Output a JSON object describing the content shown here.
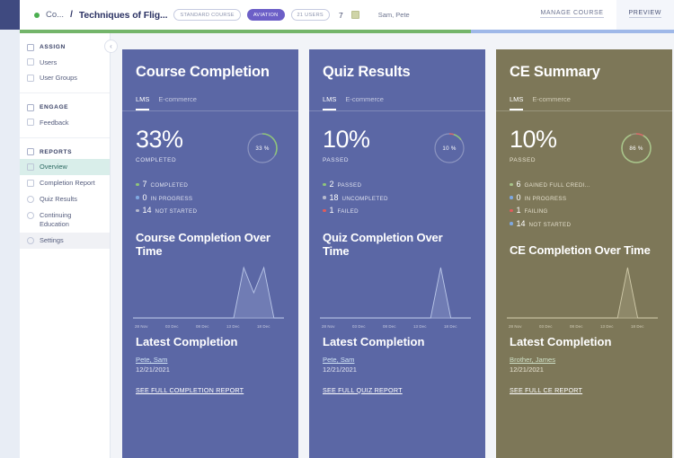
{
  "topbar": {
    "breadcrumb_parent": "Co...",
    "separator": "/",
    "title": "Techniques of Flig...",
    "badges": [
      "STANDARD COURSE",
      "AVIATION",
      "21 USERS"
    ],
    "module_count": "7",
    "assignees": "Sam, Pete",
    "manage_course": "MANAGE COURSE",
    "preview": "PREVIEW",
    "progress_percent": 69,
    "progress_color": "#74b56a",
    "progress_track_color": "#9fb8e8"
  },
  "sidebar": {
    "collapse_icon": "chevron-left-icon",
    "groups": [
      {
        "heading": "ASSIGN",
        "items": [
          {
            "label": "Users",
            "state": "normal"
          },
          {
            "label": "User Groups",
            "state": "normal"
          }
        ]
      },
      {
        "heading": "ENGAGE",
        "items": [
          {
            "label": "Feedback",
            "state": "normal"
          }
        ]
      },
      {
        "heading": "REPORTS",
        "items": [
          {
            "label": "Overview",
            "state": "active"
          },
          {
            "label": "Completion Report",
            "state": "normal"
          },
          {
            "label": "Quiz Results",
            "state": "normal"
          },
          {
            "label": "Continuing Education",
            "state": "normal"
          },
          {
            "label": "Settings",
            "state": "muted"
          }
        ]
      }
    ]
  },
  "cards": [
    {
      "theme": "blue",
      "title": "Course Completion",
      "tabs": [
        {
          "label": "LMS",
          "selected": true
        },
        {
          "label": "E-commerce",
          "selected": false
        }
      ],
      "big_percent": "33%",
      "big_label": "COMPLETED",
      "donut_label": "33 %",
      "donut_value": 33,
      "donut_segments": [
        {
          "color": "#8fc47a",
          "value": 33
        }
      ],
      "legend": [
        {
          "dot": "#8fc47a",
          "number": "7",
          "text": "COMPLETED"
        },
        {
          "dot": "#7fa8e0",
          "number": "0",
          "text": "IN PROGRESS"
        },
        {
          "dot": "#b6bace",
          "number": "14",
          "text": "NOT STARTED"
        }
      ],
      "chart_title": "Course Completion Over Time",
      "latest_title": "Latest Completion",
      "latest_name": "Pete, Sam",
      "latest_date": "12/21/2021",
      "report_link": "SEE FULL COMPLETION REPORT"
    },
    {
      "theme": "blue",
      "title": "Quiz Results",
      "tabs": [
        {
          "label": "LMS",
          "selected": true
        },
        {
          "label": "E-commerce",
          "selected": false
        }
      ],
      "big_percent": "10%",
      "big_label": "PASSED",
      "donut_label": "10 %",
      "donut_value": 10,
      "donut_segments": [
        {
          "color": "#d96a6a",
          "value": 5
        },
        {
          "color": "#8fc47a",
          "value": 10
        }
      ],
      "legend": [
        {
          "dot": "#8fc47a",
          "number": "2",
          "text": "PASSED"
        },
        {
          "dot": "#b6bace",
          "number": "18",
          "text": "UNCOMPLETED"
        },
        {
          "dot": "#e05c5c",
          "number": "1",
          "text": "FAILED"
        }
      ],
      "chart_title": "Quiz Completion Over Time",
      "latest_title": "Latest Completion",
      "latest_name": "Pete, Sam",
      "latest_date": "12/21/2021",
      "report_link": "SEE FULL QUIZ REPORT"
    },
    {
      "theme": "olive",
      "title": "CE Summary",
      "tabs": [
        {
          "label": "LMS",
          "selected": true
        },
        {
          "label": "E-commerce",
          "selected": false
        }
      ],
      "big_percent": "10%",
      "big_label": "PASSED",
      "donut_label": "86 %",
      "donut_value": 86,
      "donut_segments": [
        {
          "color": "#d96a6a",
          "value": 8
        },
        {
          "color": "#a8c48a",
          "value": 86
        }
      ],
      "legend": [
        {
          "dot": "#a8c48a",
          "number": "6",
          "text": "GAINED FULL CREDI..."
        },
        {
          "dot": "#7fa8e0",
          "number": "0",
          "text": "IN PROGRESS"
        },
        {
          "dot": "#e05c5c",
          "number": "1",
          "text": "FAILING"
        },
        {
          "dot": "#7fa8e0",
          "number": "14",
          "text": "NOT STARTED"
        }
      ],
      "chart_title": "CE Completion Over Time",
      "latest_title": "Latest Completion",
      "latest_name": "Brother, James",
      "latest_date": "12/21/2021",
      "report_link": "SEE FULL CE REPORT"
    }
  ],
  "chart_data": [
    {
      "type": "line",
      "title": "Course Completion Over Time",
      "xlabel": "",
      "ylabel": "",
      "tick_labels": [
        "28 Nov",
        "03 Dec",
        "08 Dec",
        "13 Dec",
        "18 Dec"
      ],
      "x": [
        "28 Nov",
        "30 Nov",
        "02 Dec",
        "04 Dec",
        "06 Dec",
        "08 Dec",
        "10 Dec",
        "12 Dec",
        "14 Dec",
        "16 Dec",
        "18 Dec",
        "19 Dec",
        "20 Dec",
        "21 Dec",
        "22 Dec",
        "23 Dec"
      ],
      "values": [
        0,
        0,
        0,
        0,
        0,
        0,
        0,
        0,
        0,
        0,
        0,
        4,
        2,
        4,
        0,
        0
      ],
      "ylim": [
        0,
        4
      ],
      "grid": false,
      "legend": "none",
      "line_color": "#b9c6e8"
    },
    {
      "type": "line",
      "title": "Quiz Completion Over Time",
      "xlabel": "",
      "ylabel": "",
      "tick_labels": [
        "28 Nov",
        "03 Dec",
        "08 Dec",
        "13 Dec",
        "18 Dec"
      ],
      "x": [
        "28 Nov",
        "30 Nov",
        "02 Dec",
        "04 Dec",
        "06 Dec",
        "08 Dec",
        "10 Dec",
        "12 Dec",
        "14 Dec",
        "16 Dec",
        "18 Dec",
        "19 Dec",
        "20 Dec",
        "21 Dec",
        "22 Dec",
        "23 Dec"
      ],
      "values": [
        0,
        0,
        0,
        0,
        0,
        0,
        0,
        0,
        0,
        0,
        0,
        0,
        3,
        0,
        0,
        0
      ],
      "ylim": [
        0,
        3
      ],
      "grid": false,
      "legend": "none",
      "line_color": "#b9c6e8"
    },
    {
      "type": "line",
      "title": "CE Completion Over Time",
      "xlabel": "",
      "ylabel": "",
      "tick_labels": [
        "28 Nov",
        "03 Dec",
        "08 Dec",
        "13 Dec",
        "18 Dec"
      ],
      "x": [
        "28 Nov",
        "30 Nov",
        "02 Dec",
        "04 Dec",
        "06 Dec",
        "08 Dec",
        "10 Dec",
        "12 Dec",
        "14 Dec",
        "16 Dec",
        "18 Dec",
        "19 Dec",
        "20 Dec",
        "21 Dec",
        "22 Dec",
        "23 Dec"
      ],
      "values": [
        0,
        0,
        0,
        0,
        0,
        0,
        0,
        0,
        0,
        0,
        0,
        0,
        3,
        0,
        0,
        0
      ],
      "ylim": [
        0,
        3
      ],
      "grid": false,
      "legend": "none",
      "line_color": "#cfc9a8"
    }
  ]
}
